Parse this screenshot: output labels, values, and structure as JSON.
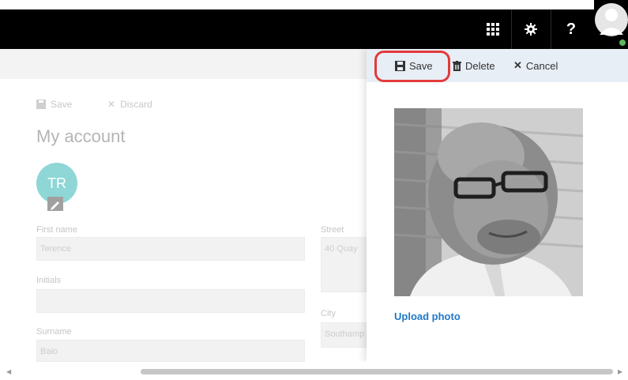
{
  "topbar": {
    "apps_icon": "app-launcher-grid-icon",
    "settings_icon": "gear-icon",
    "help_label": "?",
    "avatar_icon": "user-avatar-icon",
    "presence_color": "#5cb85c"
  },
  "background_page": {
    "save_label": "Save",
    "discard_label": "Discard",
    "title": "My account",
    "avatar_initials": "TR",
    "avatar_color": "#8fd6d6",
    "fields": {
      "first_name_label": "First name",
      "first_name_value": "Terence",
      "initials_label": "Initials",
      "initials_value": "",
      "surname_label": "Surname",
      "surname_value": "Baio",
      "street_label": "Street",
      "street_value": "40 Quay",
      "city_label": "City",
      "city_value": "Southamp"
    }
  },
  "photo_panel": {
    "commands": {
      "save_label": "Save",
      "delete_label": "Delete",
      "cancel_label": "Cancel"
    },
    "highlight_color": "#e23b3b",
    "upload_label": "Upload photo",
    "link_color": "#1f78c8"
  }
}
